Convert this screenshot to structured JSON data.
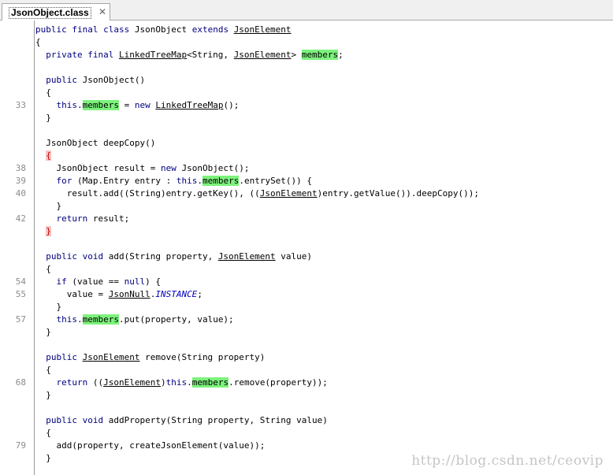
{
  "tab": {
    "title": "JsonObject.class"
  },
  "watermark": "http://blog.csdn.net/ceovip",
  "lines": [
    {
      "num": "",
      "segs": [
        [
          "kw",
          "public final class "
        ],
        [
          "",
          "JsonObject "
        ],
        [
          "kw",
          "extends "
        ],
        [
          "ref",
          "JsonElement"
        ]
      ]
    },
    {
      "num": "",
      "segs": [
        [
          "",
          "{"
        ]
      ]
    },
    {
      "num": "",
      "segs": [
        [
          "",
          "  "
        ],
        [
          "kw",
          "private final "
        ],
        [
          "ref",
          "LinkedTreeMap"
        ],
        [
          "",
          "<String, "
        ],
        [
          "ref",
          "JsonElement"
        ],
        [
          "",
          "> "
        ],
        [
          "hl",
          "members"
        ],
        [
          "",
          ";"
        ]
      ]
    },
    {
      "num": "",
      "segs": []
    },
    {
      "num": "",
      "segs": [
        [
          "",
          "  "
        ],
        [
          "kw",
          "public "
        ],
        [
          "",
          "JsonObject()"
        ]
      ]
    },
    {
      "num": "",
      "segs": [
        [
          "",
          "  {"
        ]
      ]
    },
    {
      "num": "33",
      "segs": [
        [
          "",
          "    "
        ],
        [
          "kw",
          "this"
        ],
        [
          "",
          "."
        ],
        [
          "hl",
          "members"
        ],
        [
          "",
          " = "
        ],
        [
          "kw",
          "new "
        ],
        [
          "ref",
          "LinkedTreeMap"
        ],
        [
          "",
          "();"
        ]
      ]
    },
    {
      "num": "",
      "segs": [
        [
          "",
          "  }"
        ]
      ]
    },
    {
      "num": "",
      "segs": []
    },
    {
      "num": "",
      "segs": [
        [
          "",
          "  JsonObject deepCopy()"
        ]
      ]
    },
    {
      "num": "",
      "segs": [
        [
          "",
          "  "
        ],
        [
          "brace-err",
          "{"
        ]
      ]
    },
    {
      "num": "38",
      "segs": [
        [
          "",
          "    JsonObject result = "
        ],
        [
          "kw",
          "new "
        ],
        [
          "",
          "JsonObject();"
        ]
      ]
    },
    {
      "num": "39",
      "segs": [
        [
          "",
          "    "
        ],
        [
          "kw",
          "for "
        ],
        [
          "",
          "(Map.Entry entry : "
        ],
        [
          "kw",
          "this"
        ],
        [
          "",
          "."
        ],
        [
          "hl",
          "members"
        ],
        [
          "",
          ".entrySet()) {"
        ]
      ]
    },
    {
      "num": "40",
      "segs": [
        [
          "",
          "      result.add((String)entry.getKey(), (("
        ],
        [
          "ref",
          "JsonElement"
        ],
        [
          "",
          ")entry.getValue()).deepCopy());"
        ]
      ]
    },
    {
      "num": "",
      "segs": [
        [
          "",
          "    }"
        ]
      ]
    },
    {
      "num": "42",
      "segs": [
        [
          "",
          "    "
        ],
        [
          "kw",
          "return "
        ],
        [
          "",
          "result;"
        ]
      ]
    },
    {
      "num": "",
      "segs": [
        [
          "",
          "  "
        ],
        [
          "brace-err",
          "}"
        ]
      ]
    },
    {
      "num": "",
      "segs": []
    },
    {
      "num": "",
      "segs": [
        [
          "",
          "  "
        ],
        [
          "kw",
          "public void "
        ],
        [
          "",
          "add(String property, "
        ],
        [
          "ref",
          "JsonElement"
        ],
        [
          "",
          " value)"
        ]
      ]
    },
    {
      "num": "",
      "segs": [
        [
          "",
          "  {"
        ]
      ]
    },
    {
      "num": "54",
      "segs": [
        [
          "",
          "    "
        ],
        [
          "kw",
          "if "
        ],
        [
          "",
          "(value == "
        ],
        [
          "kw",
          "null"
        ],
        [
          "",
          ") {"
        ]
      ]
    },
    {
      "num": "55",
      "segs": [
        [
          "",
          "      value = "
        ],
        [
          "ref",
          "JsonNull"
        ],
        [
          "",
          "."
        ],
        [
          "static",
          "INSTANCE"
        ],
        [
          "",
          ";"
        ]
      ]
    },
    {
      "num": "",
      "segs": [
        [
          "",
          "    }"
        ]
      ]
    },
    {
      "num": "57",
      "segs": [
        [
          "",
          "    "
        ],
        [
          "kw",
          "this"
        ],
        [
          "",
          "."
        ],
        [
          "hl",
          "members"
        ],
        [
          "",
          ".put(property, value);"
        ]
      ]
    },
    {
      "num": "",
      "segs": [
        [
          "",
          "  }"
        ]
      ]
    },
    {
      "num": "",
      "segs": []
    },
    {
      "num": "",
      "segs": [
        [
          "",
          "  "
        ],
        [
          "kw",
          "public "
        ],
        [
          "ref",
          "JsonElement"
        ],
        [
          "",
          " remove(String property)"
        ]
      ]
    },
    {
      "num": "",
      "segs": [
        [
          "",
          "  {"
        ]
      ]
    },
    {
      "num": "68",
      "segs": [
        [
          "",
          "    "
        ],
        [
          "kw",
          "return "
        ],
        [
          "",
          "(("
        ],
        [
          "ref",
          "JsonElement"
        ],
        [
          "",
          ")"
        ],
        [
          "kw",
          "this"
        ],
        [
          "",
          "."
        ],
        [
          "hl",
          "members"
        ],
        [
          "",
          ".remove(property));"
        ]
      ]
    },
    {
      "num": "",
      "segs": [
        [
          "",
          "  }"
        ]
      ]
    },
    {
      "num": "",
      "segs": []
    },
    {
      "num": "",
      "segs": [
        [
          "",
          "  "
        ],
        [
          "kw",
          "public void "
        ],
        [
          "",
          "addProperty(String property, String value)"
        ]
      ]
    },
    {
      "num": "",
      "segs": [
        [
          "",
          "  {"
        ]
      ]
    },
    {
      "num": "79",
      "segs": [
        [
          "",
          "    add(property, createJsonElement(value));"
        ]
      ]
    },
    {
      "num": "",
      "segs": [
        [
          "",
          "  }"
        ]
      ]
    }
  ]
}
